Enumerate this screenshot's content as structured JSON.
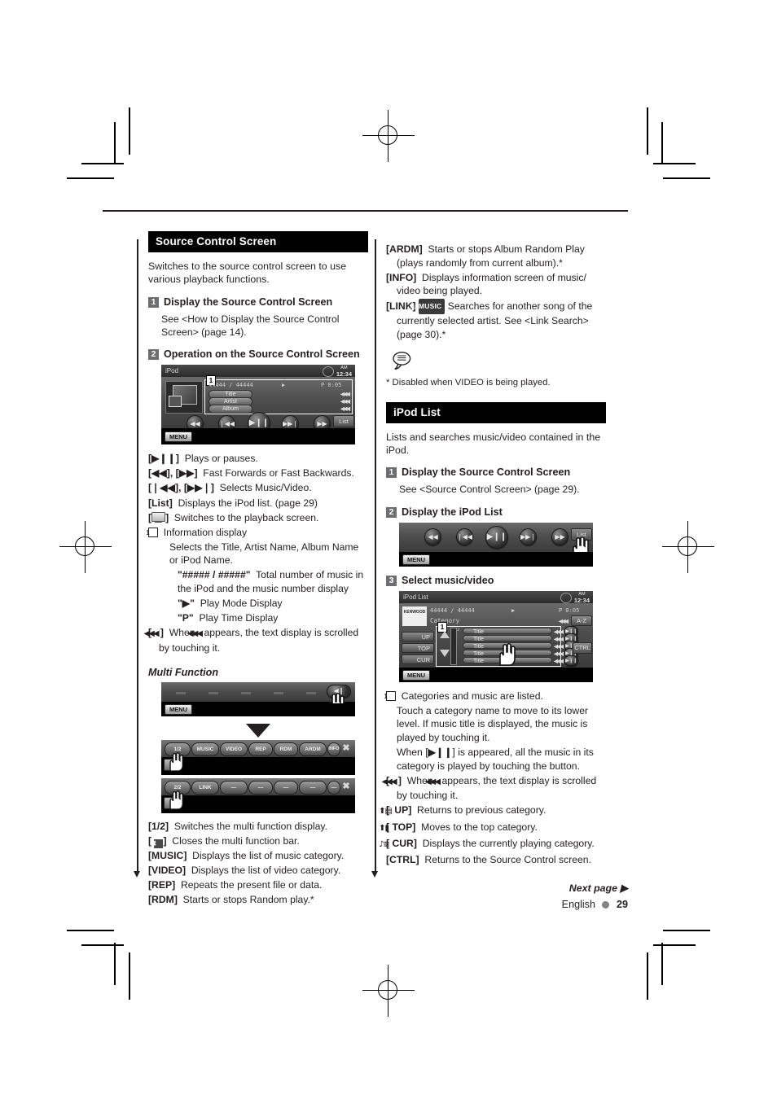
{
  "page": {
    "language": "English",
    "number": "29",
    "next_page": "Next page",
    "next_page_arrow": "▶"
  },
  "left_column": {
    "section": {
      "heading": "Source Control Screen",
      "intro": "Switches to the source control screen to use various playback functions."
    },
    "steps": [
      {
        "num": "1",
        "title": "Display the Source Control Screen",
        "body": "See <How to Display the Source Control Screen> (page 14)."
      },
      {
        "num": "2",
        "title": "Operation on the Source Control Screen"
      }
    ],
    "screenshot_source_control": {
      "title": "iPod",
      "clock_ampm": "AM",
      "clock_time": "12:34",
      "callout": "1",
      "track_counter": "44444  /  44444",
      "play_mode": "▶",
      "play_time": "P  0:05",
      "rows": [
        "Title",
        "Artist",
        "Album"
      ],
      "list_button": "List",
      "menu_button": "MENU",
      "transport": [
        "◀◀",
        "▌◀◀",
        "▶❙❙",
        "▶▶▌",
        "▶▶"
      ]
    },
    "definitions": [
      {
        "term": "[▶II]",
        "desc": "Plays or pauses.",
        "indent": 0
      },
      {
        "term": "[◀◀], [▶▶]",
        "desc": "Fast Forwards or Fast Backwards.",
        "indent": 0
      },
      {
        "term": "[I◀◀], [▶▶I]",
        "desc": "Selects Music/Video.",
        "indent": 0
      },
      {
        "term": "[List]",
        "desc": "Displays the iPod list. (page 29)",
        "indent": 0
      },
      {
        "term": "[screen-icon]",
        "desc": "Switches to the playback screen.",
        "indent": 0
      },
      {
        "term": "1",
        "desc": "Information display",
        "indent": 0
      },
      {
        "term": "",
        "desc": "Selects the Title, Artist Name, Album Name or iPod Name.",
        "indent": 1
      },
      {
        "term": "\"##### / #####\"",
        "desc": "Total number of music in the iPod and the music number display",
        "indent": 2
      },
      {
        "term": "\"▶\"",
        "desc": "Play Mode Display",
        "indent": 2
      },
      {
        "term": "\"P\"",
        "desc": "Play Time Display",
        "indent": 2
      },
      {
        "term": "[ scroll-icon ]",
        "desc": "When scroll-icon appears, the text display is scrolled by touching it.",
        "indent": 0
      }
    ],
    "multi_function": {
      "heading": "Multi Function",
      "bar1_keys": [
        "1/2",
        "MUSIC",
        "VIDEO",
        "REP",
        "RDM",
        "ARDM",
        "INFO",
        "✖"
      ],
      "bar2_keys": [
        "2/2",
        "LINK",
        "—",
        "—",
        "—",
        "—",
        "—",
        "✖"
      ],
      "menu_button": "MENU"
    },
    "mf_definitions": [
      {
        "term": "[1/2]",
        "desc": "Switches the multi function display."
      },
      {
        "term": "[ X-icon ]",
        "desc": "Closes the multi function bar."
      },
      {
        "term": "[MUSIC]",
        "desc": "Displays the list of music category."
      },
      {
        "term": "[VIDEO]",
        "desc": "Displays the list of video category."
      },
      {
        "term": "[REP]",
        "desc": "Repeats the present file or data."
      },
      {
        "term": "[RDM]",
        "desc": "Starts or stops Random play.*"
      }
    ]
  },
  "right_column": {
    "definitions_cont": [
      {
        "term": "[ARDM]",
        "desc": "Starts or stops Album Random Play (plays randomly from current album).*"
      },
      {
        "term": "[INFO]",
        "desc": "Displays information screen of music/ video being played."
      },
      {
        "term": "[LINK]",
        "badge": "MUSIC",
        "desc": "Searches for another song of the currently selected artist. See <Link Search> (page 30).*"
      }
    ],
    "note": {
      "icon": "note-balloon-icon",
      "text": "* Disabled when VIDEO is being played."
    },
    "section": {
      "heading": "iPod List",
      "intro": "Lists and searches music/video contained in the iPod."
    },
    "steps": [
      {
        "num": "1",
        "title": "Display the Source Control Screen",
        "body": "See <Source Control Screen> (page 29)."
      },
      {
        "num": "2",
        "title": "Display the iPod List"
      },
      {
        "num": "3",
        "title": "Select music/video"
      }
    ],
    "screenshot_list_button": {
      "list_button": "List",
      "menu_button": "MENU",
      "transport": [
        "◀◀",
        "▌◀◀",
        "▶❙❙",
        "▶▶▌",
        "▶▶"
      ]
    },
    "screenshot_ipod_list": {
      "title": "iPod List",
      "clock_ampm": "AM",
      "clock_time": "12:34",
      "brand": "KENWOOD",
      "track_counter": "44444  /  44444",
      "play_mode": "▶",
      "play_time": "P  0:05",
      "category_label": "Category",
      "az_button": "A-Z",
      "callout": "1",
      "side_buttons": [
        "UP",
        "TOP",
        "CUR"
      ],
      "ctrl_button": "CTRL",
      "menu_button": "MENU",
      "list_items": [
        "Title",
        "Title",
        "Title",
        "Title",
        "Title"
      ]
    },
    "list_definitions": [
      {
        "term": "1",
        "desc": "Categories and music are listed."
      },
      {
        "term": "",
        "desc": "Touch a category name to move to its lower level. If music title is displayed, the music is played by touching it."
      },
      {
        "term": "",
        "desc": "When [▶II] is appeared, all the music in its category is played by touching the button."
      },
      {
        "term": "[ scroll-icon ]",
        "desc": "When scroll-icon appears, the text display is scrolled by touching it."
      },
      {
        "term": "[up-icon UP]",
        "desc": "Returns to previous category."
      },
      {
        "term": "[top-icon TOP]",
        "desc": "Moves to the top category."
      },
      {
        "term": "[cur-icon CUR]",
        "desc": "Displays the currently playing category."
      },
      {
        "term": "[CTRL]",
        "desc": "Returns to the Source Control screen."
      }
    ]
  }
}
